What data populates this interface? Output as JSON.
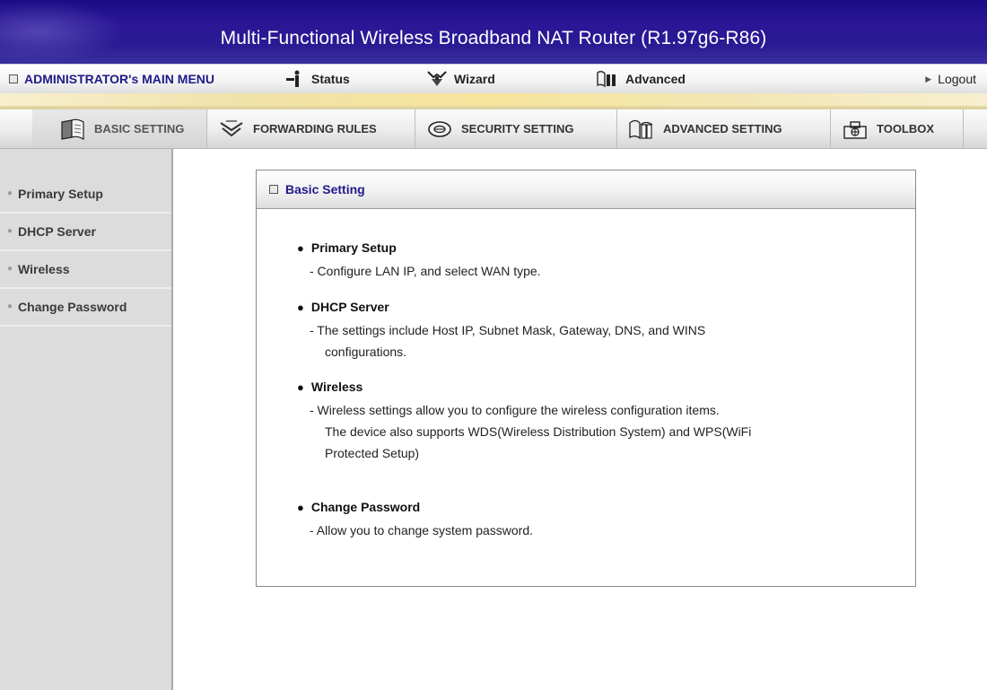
{
  "app": {
    "title": "Multi-Functional Wireless Broadband NAT Router (R1.97g6-R86)"
  },
  "main_menu": {
    "admin_label": "ADMINISTRATOR's MAIN MENU",
    "status_label": "Status",
    "wizard_label": "Wizard",
    "advanced_label": "Advanced",
    "logout_label": "Logout"
  },
  "tabs": [
    {
      "label": "BASIC SETTING",
      "icon": "book-icon",
      "active": true
    },
    {
      "label": "FORWARDING RULES",
      "icon": "arrows-icon",
      "active": false
    },
    {
      "label": "SECURITY SETTING",
      "icon": "disc-icon",
      "active": false
    },
    {
      "label": "ADVANCED SETTING",
      "icon": "book-wings-icon",
      "active": false
    },
    {
      "label": "TOOLBOX",
      "icon": "toolbox-icon",
      "active": false
    }
  ],
  "sidebar": {
    "items": [
      {
        "label": "Primary Setup"
      },
      {
        "label": "DHCP Server"
      },
      {
        "label": "Wireless"
      },
      {
        "label": "Change Password"
      }
    ]
  },
  "panel": {
    "title": "Basic Setting",
    "entries": [
      {
        "title": "Primary Setup",
        "desc": [
          "- Configure LAN IP, and select WAN type."
        ]
      },
      {
        "title": "DHCP Server",
        "desc": [
          "- The settings include Host IP, Subnet Mask, Gateway, DNS, and WINS",
          "configurations."
        ]
      },
      {
        "title": "Wireless",
        "desc": [
          "- Wireless settings allow you to configure the wireless configuration items.",
          "The device also supports WDS(Wireless Distribution System) and WPS(WiFi",
          "Protected Setup)"
        ]
      },
      {
        "title": "Change Password",
        "desc": [
          "- Allow you to change system password."
        ]
      }
    ]
  },
  "colors": {
    "banner": "#2a1696",
    "menu_accent": "#201a8a",
    "gold_band": "#f1e2a8",
    "sidebar_bg": "#dcdcdc"
  }
}
